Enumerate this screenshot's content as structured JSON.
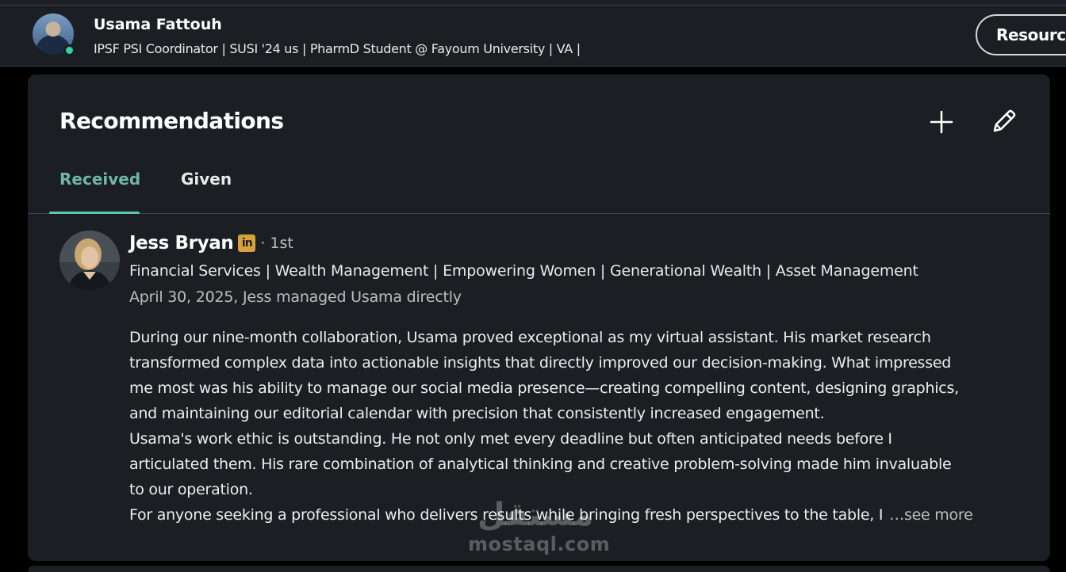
{
  "header": {
    "name": "Usama Fattouh",
    "headline": "IPSF PSI Coordinator | SUSI '24 us | PharmD Student @ Fayoum University | VA |",
    "resources_label": "Resources",
    "presence_color": "#2ed3a0"
  },
  "recommendations": {
    "title": "Recommendations",
    "add_icon": "plus-icon",
    "edit_icon": "pencil-icon",
    "tabs": [
      {
        "label": "Received",
        "selected": true
      },
      {
        "label": "Given",
        "selected": false
      }
    ],
    "accent_color": "#5cc7a9",
    "item": {
      "name": "Jess Bryan",
      "badge": "in",
      "degree": "· 1st",
      "headline": "Financial Services | Wealth Management | Empowering Women | Generational Wealth | Asset Management",
      "meta": "April 30, 2025, Jess managed Usama directly",
      "body_lines": [
        "During our nine-month collaboration, Usama proved exceptional as my virtual assistant. His market research",
        "transformed complex data into actionable insights that directly improved our decision-making. What impressed",
        "me most was his ability to manage our social media presence—creating compelling content, designing graphics,",
        "and maintaining our editorial calendar with precision that consistently increased engagement.",
        "Usama's work ethic is outstanding. He not only met every deadline but often anticipated needs before I",
        "articulated them. His rare combination of analytical thinking and creative problem-solving made him invaluable",
        "to our operation.",
        "For anyone seeking a professional who delivers results while bringing fresh perspectives to the table, I"
      ],
      "see_more_label": "…see more"
    }
  },
  "watermark": {
    "arabic": "مستقل",
    "latin": "mostaql.com"
  }
}
